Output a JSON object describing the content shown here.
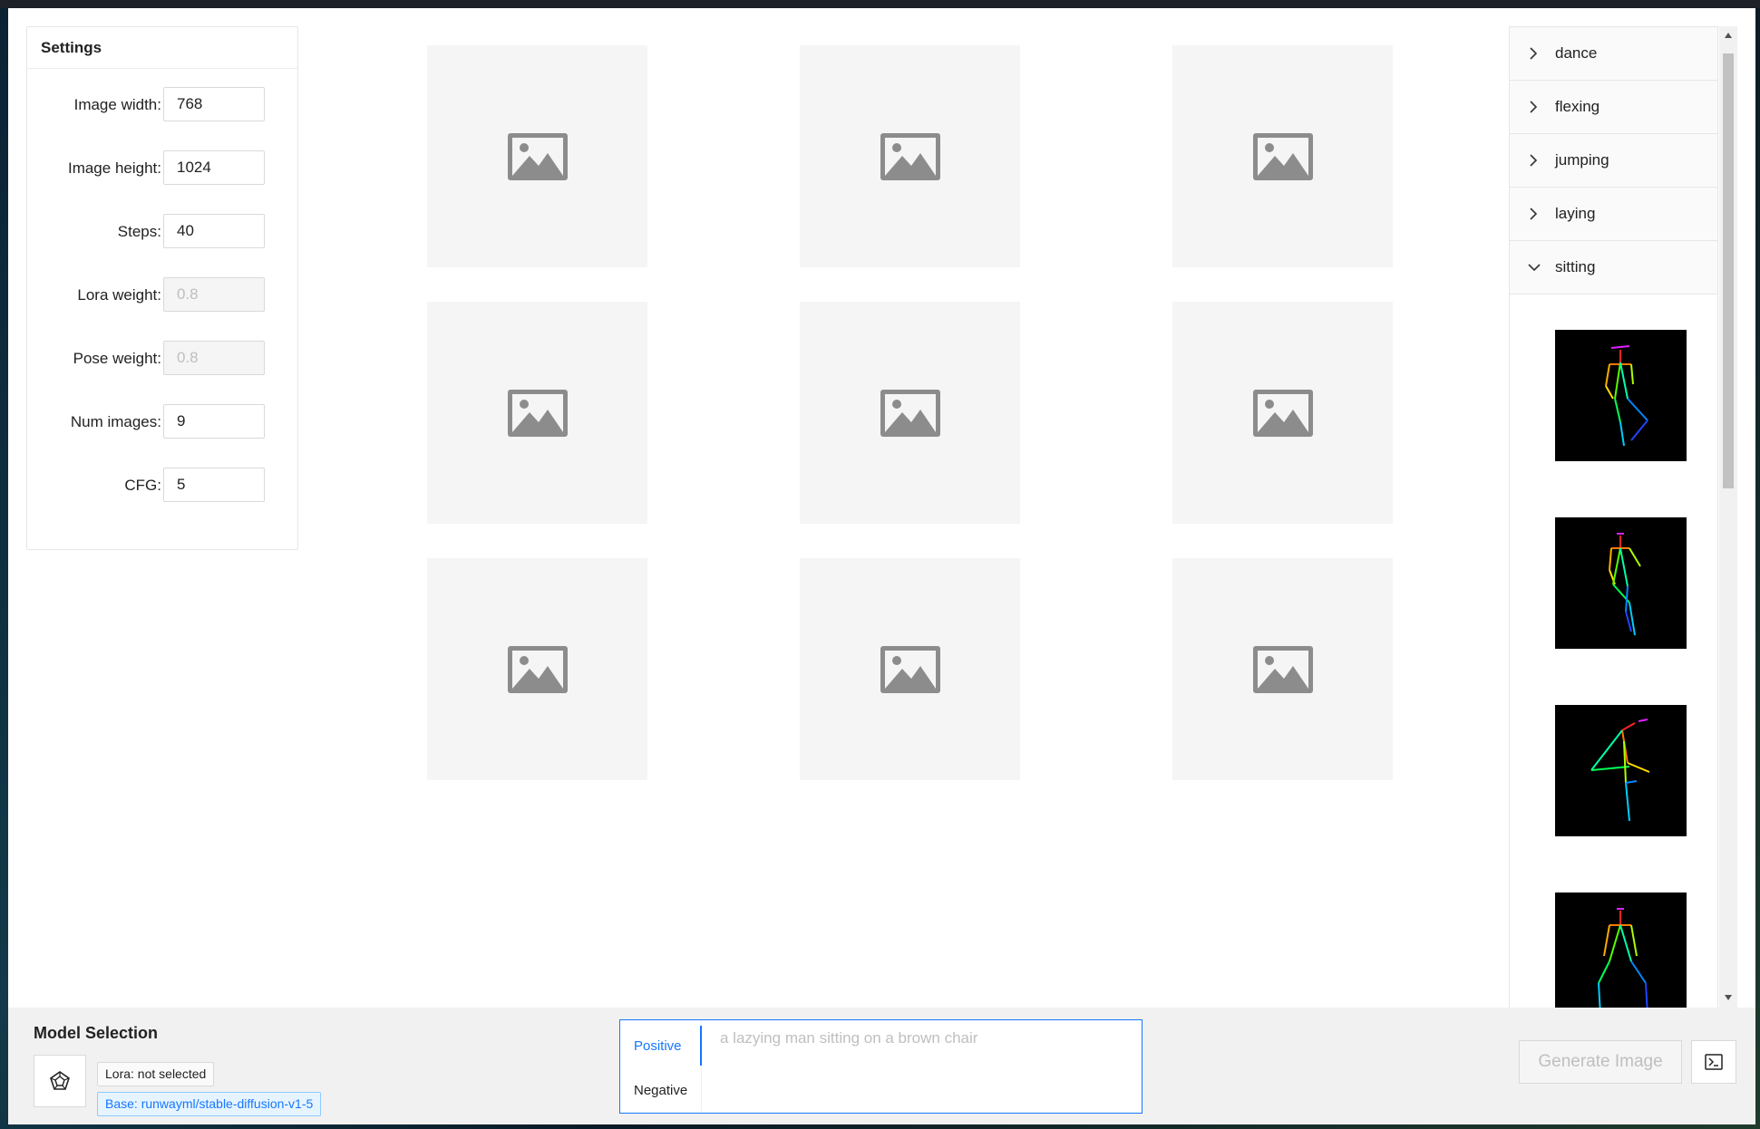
{
  "settings": {
    "title": "Settings",
    "fields": [
      {
        "label": "Image width",
        "value": "768",
        "disabled": false
      },
      {
        "label": "Image height",
        "value": "1024",
        "disabled": false
      },
      {
        "label": "Steps",
        "value": "40",
        "disabled": false
      },
      {
        "label": "Lora weight",
        "value": "0.8",
        "disabled": true
      },
      {
        "label": "Pose weight",
        "value": "0.8",
        "disabled": true
      },
      {
        "label": "Num images",
        "value": "9",
        "disabled": false
      },
      {
        "label": "CFG",
        "value": "5",
        "disabled": false
      }
    ]
  },
  "gallery": {
    "count": 9,
    "icon": "image-placeholder-icon"
  },
  "poses": {
    "categories": [
      {
        "label": "dance",
        "expanded": false
      },
      {
        "label": "flexing",
        "expanded": false
      },
      {
        "label": "jumping",
        "expanded": false
      },
      {
        "label": "laying",
        "expanded": false
      },
      {
        "label": "sitting",
        "expanded": true
      }
    ],
    "thumbnail_count": 4
  },
  "bottom": {
    "model_title": "Model Selection",
    "lora_tag": "Lora: not selected",
    "base_tag": "Base: runwayml/stable-diffusion-v1-5",
    "prompt_tabs": [
      "Positive",
      "Negative"
    ],
    "prompt_placeholder": "a lazying man sitting on a brown chair",
    "generate_label": "Generate Image"
  },
  "colors": {
    "accent": "#1677ff",
    "placeholder_bg": "#f5f5f5",
    "bottom_bg": "#f1f1f1"
  }
}
